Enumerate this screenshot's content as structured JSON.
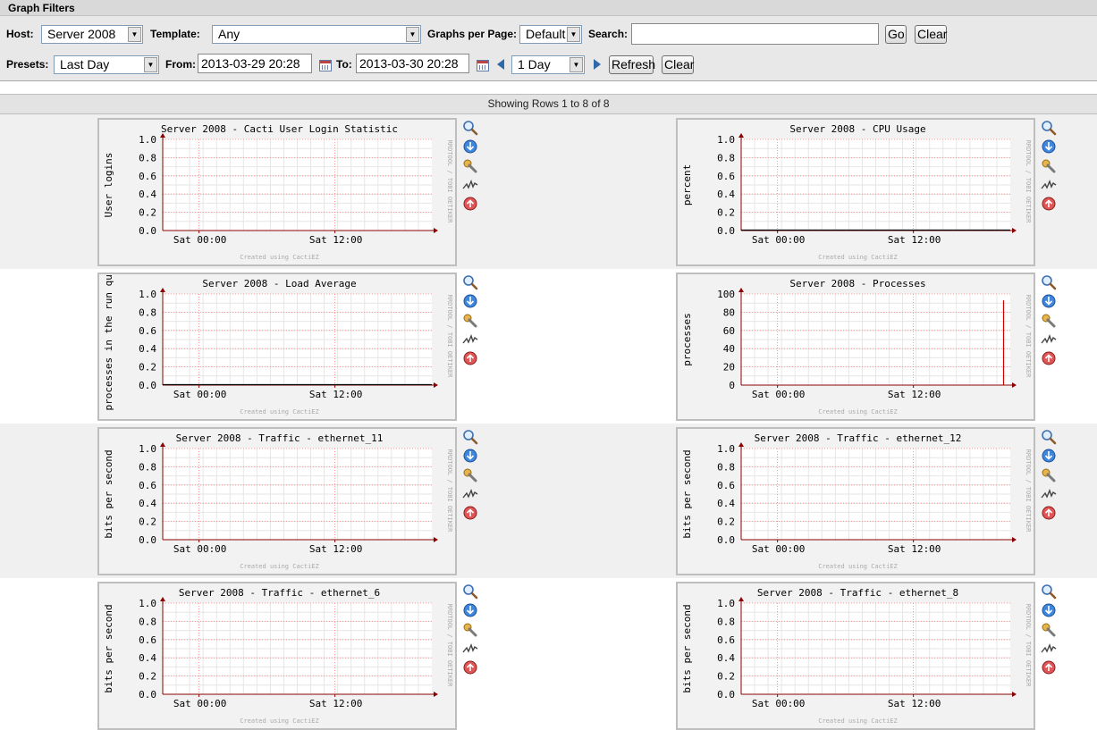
{
  "filters": {
    "title": "Graph Filters",
    "host_label": "Host:",
    "host_value": "Server 2008",
    "template_label": "Template:",
    "template_value": "Any",
    "graphs_per_page_label": "Graphs per Page:",
    "graphs_per_page_value": "Default",
    "search_label": "Search:",
    "search_value": "",
    "go_label": "Go",
    "clear_label": "Clear",
    "presets_label": "Presets:",
    "presets_value": "Last Day",
    "from_label": "From:",
    "from_value": "2013-03-29 20:28",
    "to_label": "To:",
    "to_value": "2013-03-30 20:28",
    "timespan_value": "1 Day",
    "refresh_label": "Refresh",
    "clear2_label": "Clear"
  },
  "pagination": {
    "showing_text": "Showing Rows 1 to 8 of 8"
  },
  "graph_common": {
    "x_ticks": [
      "Sat 00:00",
      "Sat 12:00"
    ],
    "footer": "Created using CactiEZ",
    "side_text": "RRDTOOL / TOBI OETIKER"
  },
  "icon_names": [
    "zoom-icon",
    "export-icon",
    "edit-icon",
    "realtime-icon",
    "move-up-icon"
  ],
  "colors": {
    "filter_bg": "#e8e8e8",
    "band_gray": "#f0f0f0",
    "axis": "#8b0000",
    "grid": "#ff8080"
  },
  "graphs": [
    {
      "title": "Server 2008 - Cacti User Login Statistic",
      "ylabel": "User logins",
      "y_ticks": [
        "1.0",
        "0.8",
        "0.6",
        "0.4",
        "0.2",
        "0.0"
      ],
      "series_line": "none",
      "spike": null
    },
    {
      "title": "Server 2008 - CPU Usage",
      "ylabel": "percent",
      "y_ticks": [
        "1.0",
        "0.8",
        "0.6",
        "0.4",
        "0.2",
        "0.0"
      ],
      "series_line": "flat",
      "spike": null
    },
    {
      "title": "Server 2008 - Load Average",
      "ylabel": "processes in the run que",
      "y_ticks": [
        "1.0",
        "0.8",
        "0.6",
        "0.4",
        "0.2",
        "0.0"
      ],
      "series_line": "flat",
      "spike": null
    },
    {
      "title": "Server 2008 - Processes",
      "ylabel": "processes",
      "y_ticks": [
        "100",
        "80",
        "60",
        "40",
        "20",
        "0"
      ],
      "series_line": "none",
      "spike": {
        "x_fraction": 0.975,
        "value": 93
      }
    },
    {
      "title": "Server 2008 - Traffic - ethernet_11",
      "ylabel": "bits per second",
      "y_ticks": [
        "1.0",
        "0.8",
        "0.6",
        "0.4",
        "0.2",
        "0.0"
      ],
      "series_line": "none",
      "spike": null
    },
    {
      "title": "Server 2008 - Traffic - ethernet_12",
      "ylabel": "bits per second",
      "y_ticks": [
        "1.0",
        "0.8",
        "0.6",
        "0.4",
        "0.2",
        "0.0"
      ],
      "series_line": "none",
      "spike": null
    },
    {
      "title": "Server 2008 - Traffic - ethernet_6",
      "ylabel": "bits per second",
      "y_ticks": [
        "1.0",
        "0.8",
        "0.6",
        "0.4",
        "0.2",
        "0.0"
      ],
      "series_line": "none",
      "spike": null
    },
    {
      "title": "Server 2008 - Traffic - ethernet_8",
      "ylabel": "bits per second",
      "y_ticks": [
        "1.0",
        "0.8",
        "0.6",
        "0.4",
        "0.2",
        "0.0"
      ],
      "series_line": "none",
      "spike": null
    }
  ]
}
